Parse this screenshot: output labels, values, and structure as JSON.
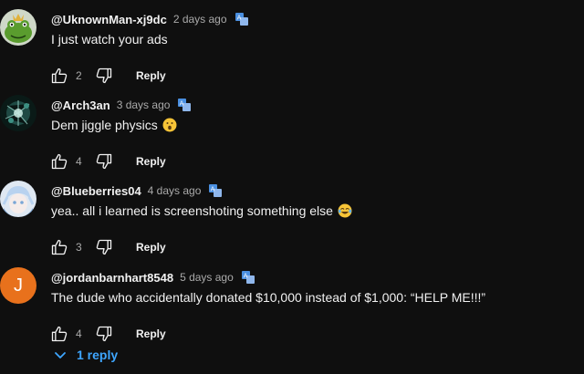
{
  "comments": [
    {
      "author": "@UknownMan-xj9dc",
      "time": "2 days ago",
      "text": "I just watch your ads",
      "emoji": "",
      "likes": "2",
      "reply_label": "Reply",
      "avatar_icon": "frog-king-avatar",
      "avatar_colors": [
        "#5a9c2e",
        "#1e3d10"
      ]
    },
    {
      "author": "@Arch3an",
      "time": "3 days ago",
      "text": "Dem jiggle physics",
      "emoji": "face-with-open-mouth-emoji",
      "likes": "4",
      "reply_label": "Reply",
      "avatar_icon": "dark-teal-abstract-avatar",
      "avatar_colors": [
        "#1f4a44",
        "#0a1a17"
      ]
    },
    {
      "author": "@Blueberries04",
      "time": "4 days ago",
      "text": "yea.. all i learned is screenshoting something else",
      "emoji": "face-with-tears-of-joy-emoji",
      "likes": "3",
      "reply_label": "Reply",
      "avatar_icon": "anime-character-avatar",
      "avatar_colors": [
        "#dfe8f2",
        "#7aa6d6"
      ]
    },
    {
      "author": "@jordanbarnhart8548",
      "time": "5 days ago",
      "text": "The dude who accidentally donated $10,000 instead of $1,000: “HELP ME!!!”",
      "emoji": "",
      "likes": "4",
      "reply_label": "Reply",
      "avatar_letter": "J",
      "avatar_colors": [
        "#e8711c"
      ]
    }
  ],
  "replies": {
    "label": "1 reply",
    "color": "#3ea6ff"
  },
  "colors": {
    "background": "#0f0f0f",
    "text_primary": "#f1f1f1",
    "text_secondary": "#aaaaaa",
    "translate_badge": "#4a8fe0"
  }
}
